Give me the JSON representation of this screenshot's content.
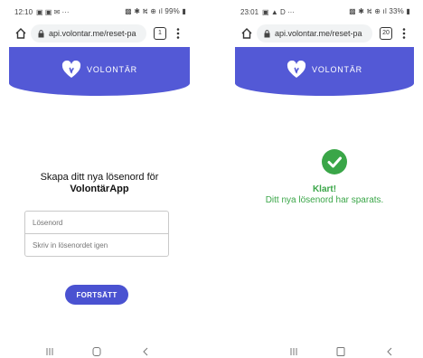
{
  "left": {
    "status": {
      "time": "12:10",
      "notifications": "▣ ▣ ✉ ···",
      "system": "▩ ✱ ⛕ ⊕ ıl 99% ▮"
    },
    "browser": {
      "url": "api.volontar.me/reset-pa",
      "tab_count": "1"
    },
    "brand": {
      "name": "VOLONTÄR"
    },
    "form": {
      "title_line1": "Skapa ditt nya lösenord för",
      "title_line2": "VolontärApp",
      "password_placeholder": "Lösenord",
      "repeat_placeholder": "Skriv in lösenordet igen",
      "submit_label": "FORTSÄTT"
    }
  },
  "right": {
    "status": {
      "time": "23:01",
      "notifications": "▣ ▲ D ···",
      "system": "▩ ✱ ⛕ ⊕ ıl 33% ▮"
    },
    "browser": {
      "url": "api.volontar.me/reset-pa",
      "tab_count": "20"
    },
    "brand": {
      "name": "VOLONTÄR"
    },
    "success": {
      "title": "Klart!",
      "message": "Ditt nya lösenord har sparats."
    }
  },
  "colors": {
    "brand": "#5359d6",
    "button": "#4a52d1",
    "success": "#3aa648"
  },
  "icons": [
    "home-icon",
    "lock-icon",
    "tab-switcher-icon",
    "menu-dots-icon",
    "heart-hand-logo-icon",
    "check-circle-icon",
    "recent-apps-icon",
    "home-nav-icon",
    "back-nav-icon"
  ]
}
